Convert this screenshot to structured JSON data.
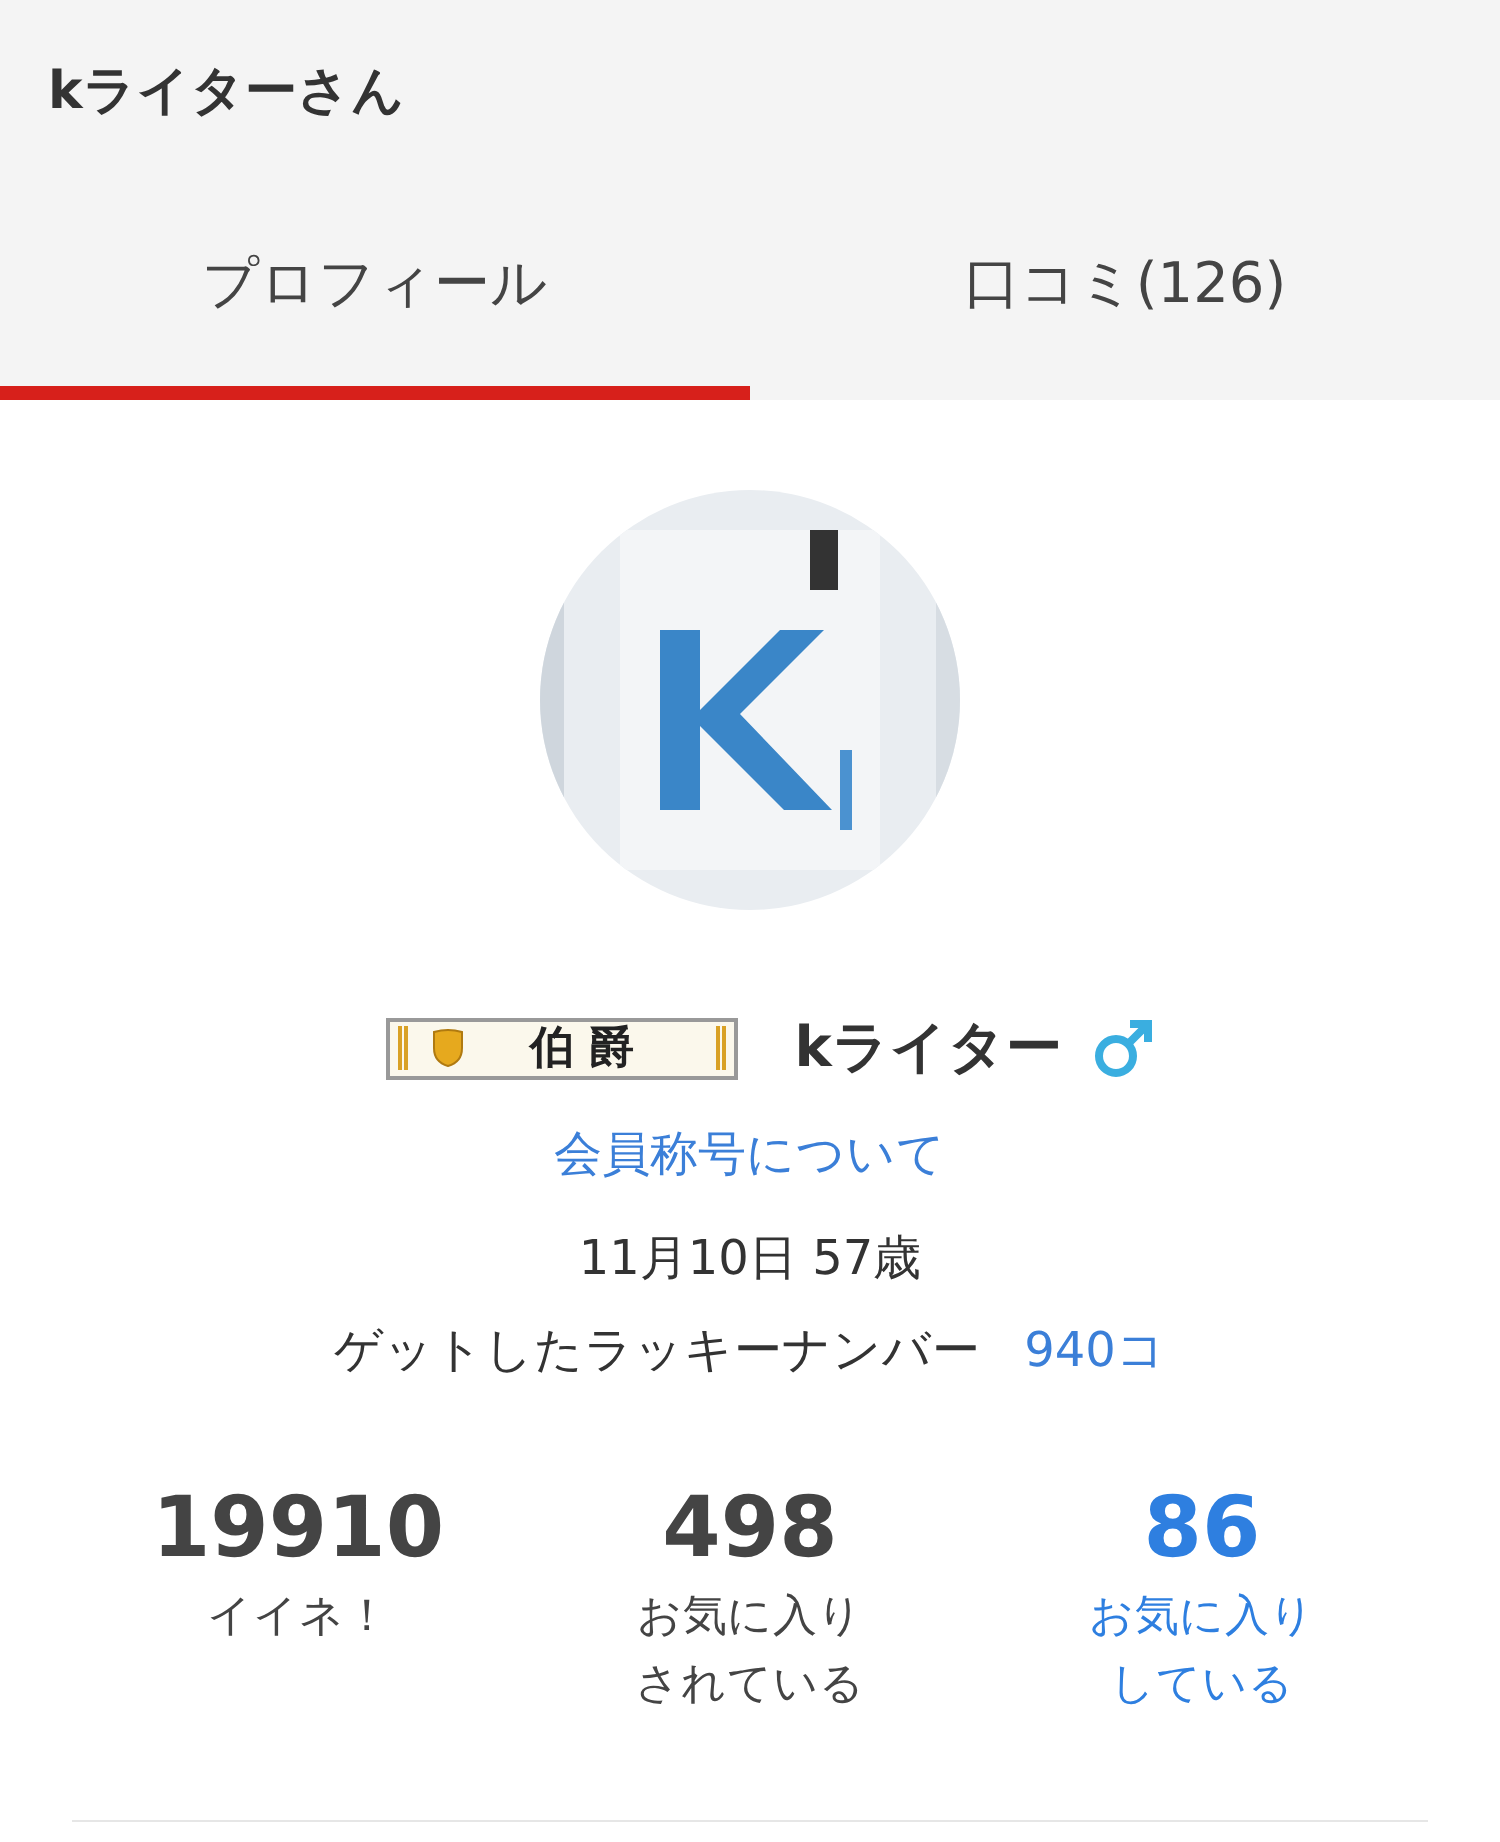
{
  "header": {
    "title": "kライターさん"
  },
  "tabs": [
    {
      "label": "プロフィール",
      "selected": true
    },
    {
      "label": "口コミ(126)",
      "selected": false
    }
  ],
  "profile": {
    "rank_badge": "伯爵",
    "name": "kライター",
    "gender": {
      "kind": "male"
    },
    "title_link": "会員称号について",
    "birthday_age": "11月10日 57歳",
    "lucky_label": "ゲットしたラッキーナンバー",
    "lucky_count": "940コ"
  },
  "stats": [
    {
      "value": "19910",
      "label": "イイネ！",
      "kind": "plain"
    },
    {
      "value": "498",
      "label": "お気に入りされている",
      "kind": "plain"
    },
    {
      "value": "86",
      "label": "お気に入りしている",
      "kind": "link"
    }
  ]
}
